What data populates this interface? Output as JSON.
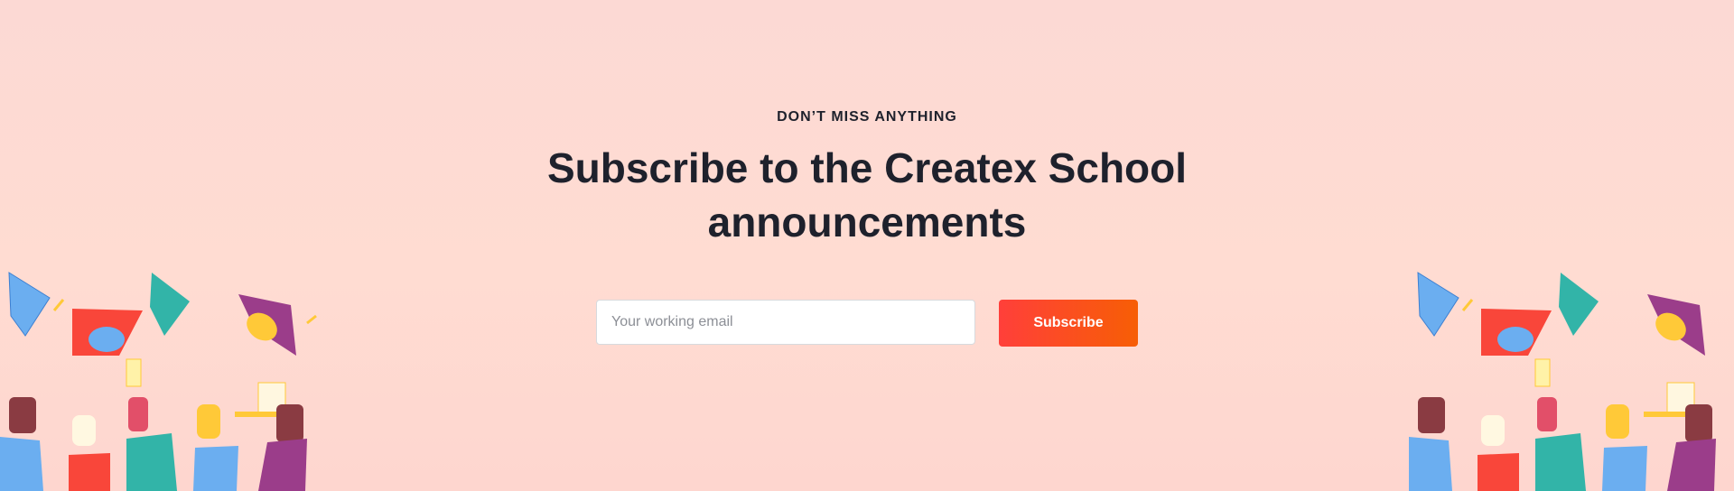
{
  "subscribe_section": {
    "eyebrow": "DON’T MISS ANYTHING",
    "title_line1": "Subscribe to the Createx School",
    "title_line2": "announcements",
    "email_placeholder": "Your working email",
    "email_value": "",
    "button_label": "Subscribe"
  },
  "colors": {
    "background": "#ffdcd2",
    "accent_start": "#ff3f3a",
    "accent_end": "#f75e05",
    "heading": "#1e212c"
  },
  "illustrations": {
    "left": "graduation-celebration-illustration",
    "right": "graduation-celebration-illustration"
  }
}
